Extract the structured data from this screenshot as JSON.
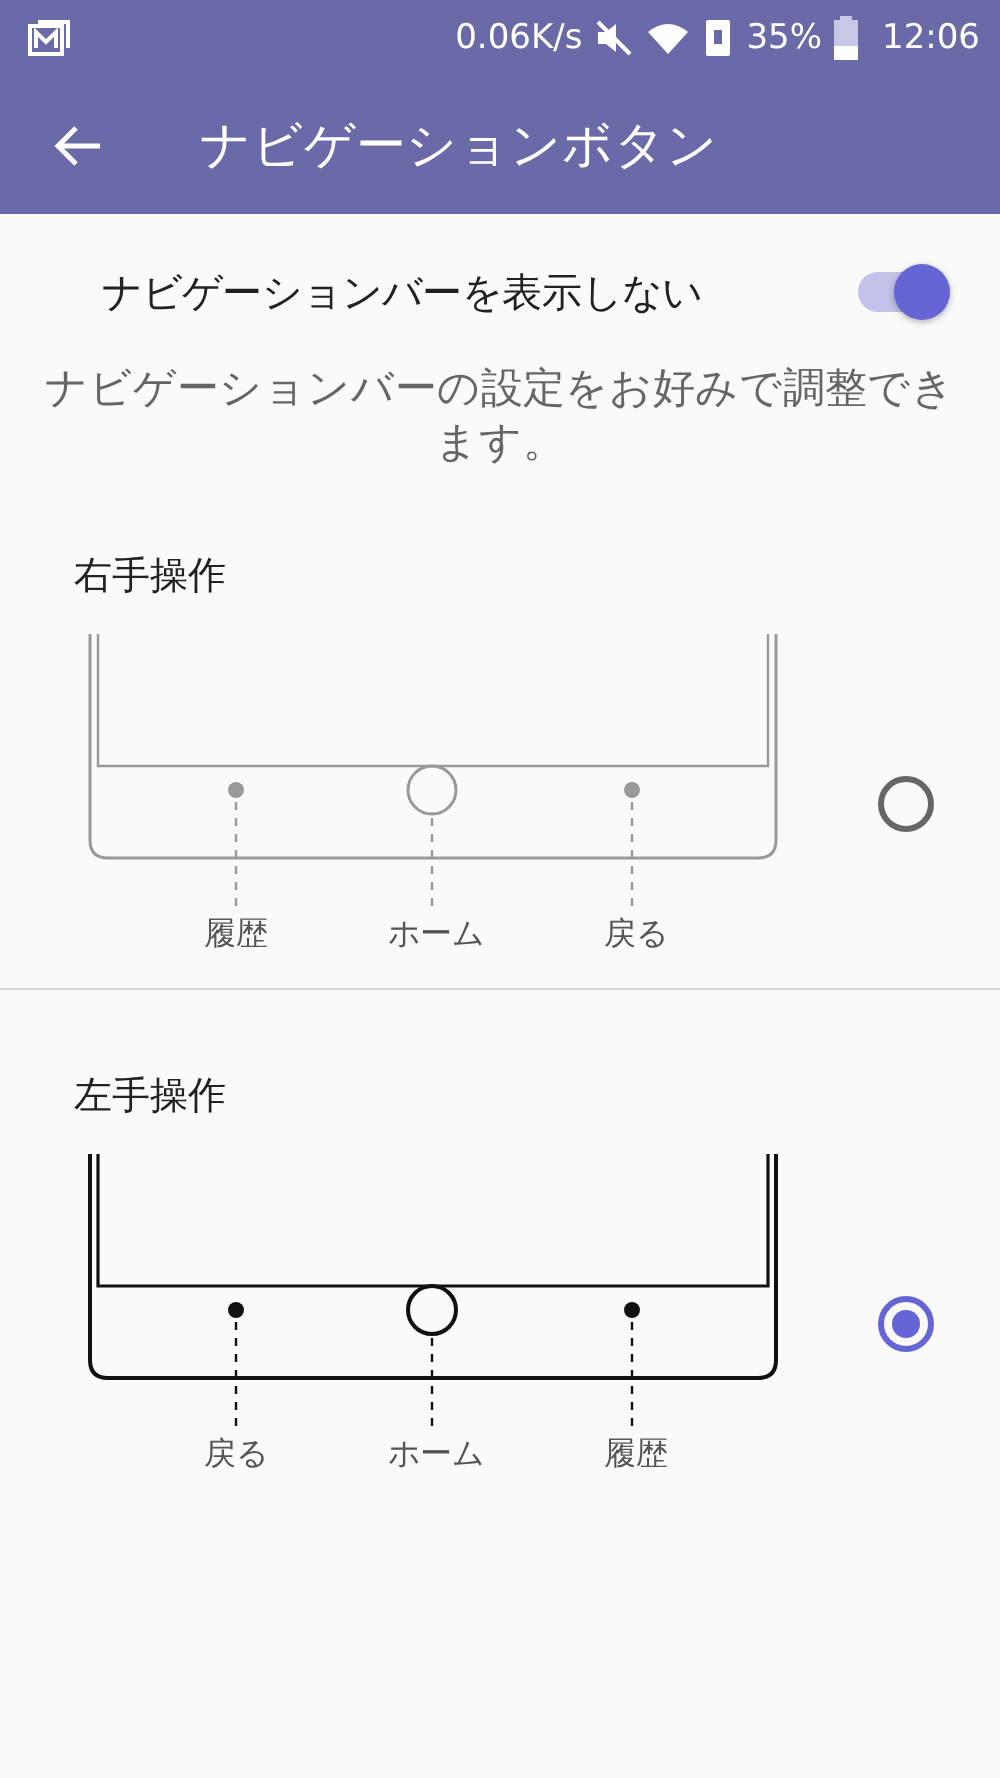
{
  "status_bar": {
    "net_speed": "0.06K/s",
    "battery": "35%",
    "time": "12:06"
  },
  "app_bar": {
    "title": "ナビゲーションボタン"
  },
  "toggle": {
    "label": "ナビゲーションバーを表示しない",
    "on": true
  },
  "description": "ナビゲーションバーの設定をお好みで調整できます。",
  "options": [
    {
      "title": "右手操作",
      "selected": false,
      "buttons": [
        "履歴",
        "ホーム",
        "戻る"
      ]
    },
    {
      "title": "左手操作",
      "selected": true,
      "buttons": [
        "戻る",
        "ホーム",
        "履歴"
      ]
    }
  ]
}
